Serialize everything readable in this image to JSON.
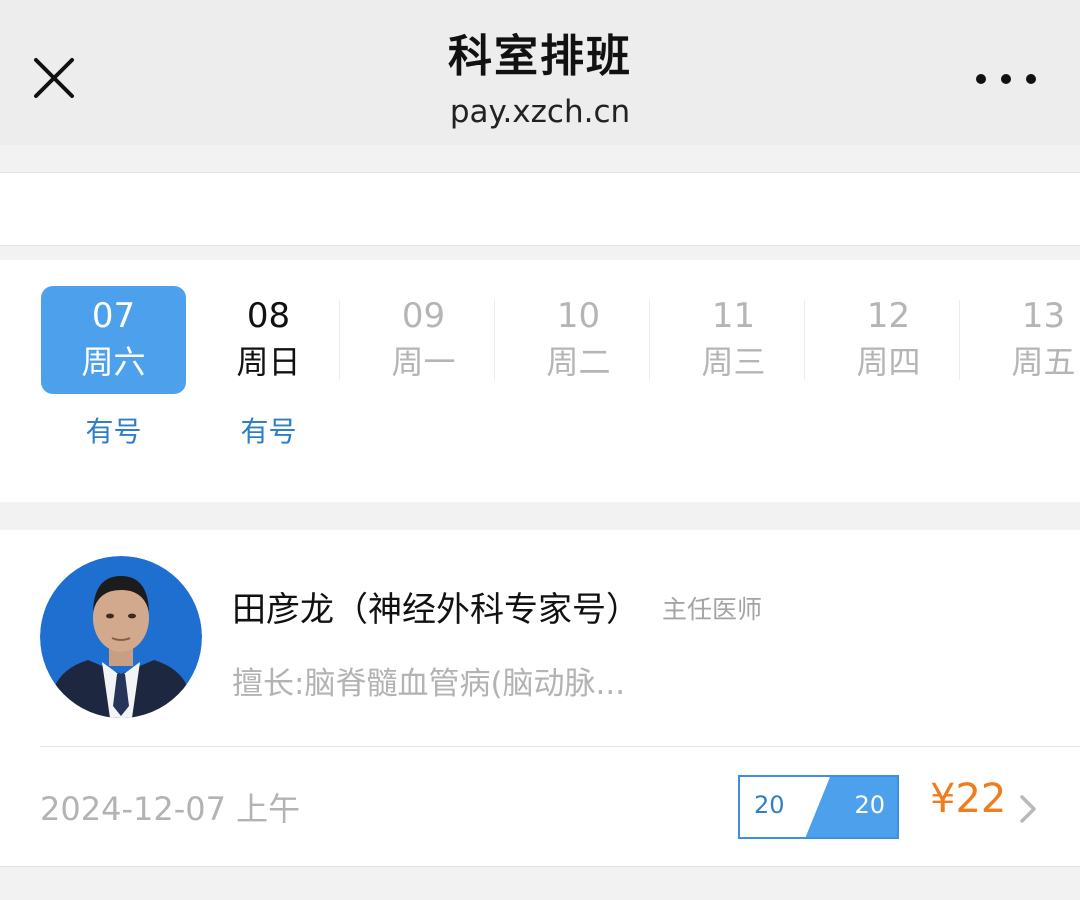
{
  "header": {
    "title": "科室排班",
    "subtitle": "pay.xzch.cn",
    "close_icon": "close-icon",
    "more_icon": "more-dots-icon"
  },
  "dates": [
    {
      "num": "07",
      "weekday": "周六",
      "status": "有号",
      "state": "selected"
    },
    {
      "num": "08",
      "weekday": "周日",
      "status": "有号",
      "state": "active"
    },
    {
      "num": "09",
      "weekday": "周一",
      "status": "",
      "state": "disabled"
    },
    {
      "num": "10",
      "weekday": "周二",
      "status": "",
      "state": "disabled"
    },
    {
      "num": "11",
      "weekday": "周三",
      "status": "",
      "state": "disabled"
    },
    {
      "num": "12",
      "weekday": "周四",
      "status": "",
      "state": "disabled"
    },
    {
      "num": "13",
      "weekday": "周五",
      "status": "",
      "state": "disabled"
    }
  ],
  "doctor": {
    "name": "田彦龙（神经外科专家号）",
    "title": "主任医师",
    "specialty": "擅长:脑脊髓血管病(脑动脉...",
    "slot": {
      "date": "2024-12-07 上午",
      "remaining": "20",
      "total": "20",
      "price": "¥22"
    }
  },
  "colors": {
    "accent": "#4da1ec",
    "link": "#2f7fc8",
    "price": "#f07d1d",
    "muted": "#b3b3b3"
  }
}
